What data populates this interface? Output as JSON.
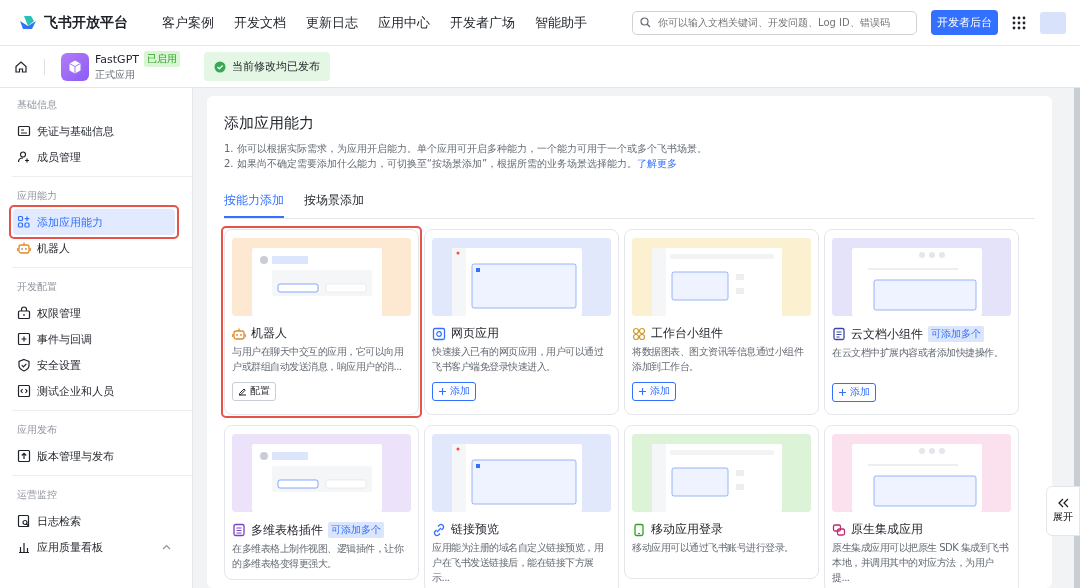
{
  "header": {
    "brand": "飞书开放平台",
    "nav": [
      "客户案例",
      "开发文档",
      "更新日志",
      "应用中心",
      "开发者广场",
      "智能助手"
    ],
    "search": {
      "placeholder": "你可以输入文档关键词、开发问题、Log ID、错误码"
    },
    "console_button": "开发者后台"
  },
  "app_bar": {
    "app_name": "FastGPT",
    "status": "已启用",
    "subtitle": "正式应用",
    "notice": "当前修改均已发布"
  },
  "sidebar": [
    {
      "title": "基础信息",
      "items": [
        {
          "label": "凭证与基础信息",
          "selected": false,
          "highlighted": false
        },
        {
          "label": "成员管理",
          "selected": false,
          "highlighted": false
        }
      ]
    },
    {
      "title": "应用能力",
      "items": [
        {
          "label": "添加应用能力",
          "selected": true,
          "highlighted": true
        },
        {
          "label": "机器人",
          "selected": false,
          "highlighted": false
        }
      ]
    },
    {
      "title": "开发配置",
      "items": [
        {
          "label": "权限管理",
          "selected": false,
          "highlighted": false
        },
        {
          "label": "事件与回调",
          "selected": false,
          "highlighted": false
        },
        {
          "label": "安全设置",
          "selected": false,
          "highlighted": false
        },
        {
          "label": "测试企业和人员",
          "selected": false,
          "highlighted": false
        }
      ]
    },
    {
      "title": "应用发布",
      "items": [
        {
          "label": "版本管理与发布",
          "selected": false,
          "highlighted": false
        }
      ]
    },
    {
      "title": "运营监控",
      "items": [
        {
          "label": "日志检索",
          "selected": false,
          "highlighted": false
        },
        {
          "label": "应用质量看板",
          "selected": false,
          "highlighted": false,
          "expanded": true
        }
      ]
    }
  ],
  "main": {
    "title": "添加应用能力",
    "notes": [
      {
        "text": "1. 你可以根据实际需求，为应用开启能力。单个应用可开启多种能力，一个能力可用于一个或多个飞书场景。"
      },
      {
        "text": "2. 如果尚不确定需要添加什么能力，可切换至“按场景添加”，根据所需的业务场景选择能力。",
        "link": "了解更多"
      }
    ],
    "tabs": [
      {
        "label": "按能力添加",
        "selected": true
      },
      {
        "label": "按场景添加",
        "selected": false
      }
    ],
    "cards": [
      {
        "title": "机器人",
        "color": "#fde8d2",
        "description": "与用户在聊天中交互的应用，它可以向用户或群组自动发送消息，响应用户的消...",
        "action": {
          "kind": "configure",
          "label": "配置"
        },
        "highlighted": true
      },
      {
        "title": "网页应用",
        "color": "#e1e8fb",
        "description": "快速接入已有的网页应用，用户可以通过飞书客户端免登录快速进入。",
        "action": {
          "kind": "add",
          "label": "添加"
        },
        "highlighted": false
      },
      {
        "title": "工作台小组件",
        "color": "#fbf0cf",
        "description": "将数据图表、图文资讯等信息通过小组件添加到工作台。",
        "action": {
          "kind": "add",
          "label": "添加"
        },
        "highlighted": false
      },
      {
        "title": "云文档小组件",
        "color": "#e4e3fa",
        "tag": "可添加多个",
        "description": "在云文档中扩展内容或者添加快捷操作。",
        "action": {
          "kind": "add",
          "label": "添加"
        },
        "highlighted": false
      },
      {
        "title": "多维表格插件",
        "color": "#ece3fa",
        "tag": "可添加多个",
        "description": "在多维表格上制作视图、逻辑插件，让你的多维表格变得更强大。",
        "highlighted": false
      },
      {
        "title": "链接预览",
        "color": "#e1e8fb",
        "description": "应用能为注册的域名自定义链接预览，用户在飞书发送链接后，能在链接下方展示...",
        "highlighted": false
      },
      {
        "title": "移动应用登录",
        "color": "#dcf3d8",
        "description": "移动应用可以通过飞书账号进行登录。",
        "highlighted": false
      },
      {
        "title": "原生集成应用",
        "color": "#fbe0ee",
        "description": "原生集成应用可以把原生 SDK 集成到飞书本地，并调用其中的对应方法，为用户提...",
        "highlighted": false
      }
    ]
  },
  "expand_button": "展开"
}
